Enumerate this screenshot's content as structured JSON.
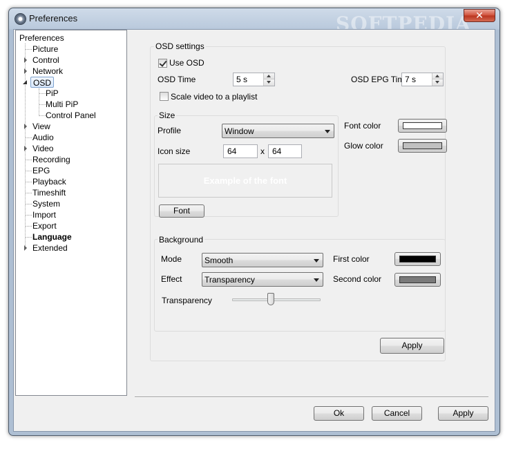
{
  "window": {
    "title": "Preferences",
    "watermark": "SOFTPEDIA",
    "close_symbol": "✕"
  },
  "tree": {
    "root": "Preferences",
    "items": [
      {
        "label": "Picture",
        "has_children": false
      },
      {
        "label": "Control",
        "has_children": true
      },
      {
        "label": "Network",
        "has_children": true
      },
      {
        "label": "OSD",
        "has_children": true,
        "expanded": true,
        "selected": true,
        "children": [
          "PiP",
          "Multi PiP",
          "Control Panel"
        ]
      },
      {
        "label": "View",
        "has_children": true
      },
      {
        "label": "Audio",
        "has_children": false
      },
      {
        "label": "Video",
        "has_children": true
      },
      {
        "label": "Recording",
        "has_children": false
      },
      {
        "label": "EPG",
        "has_children": false
      },
      {
        "label": "Playback",
        "has_children": false
      },
      {
        "label": "Timeshift",
        "has_children": false
      },
      {
        "label": "System",
        "has_children": false
      },
      {
        "label": "Import",
        "has_children": false
      },
      {
        "label": "Export",
        "has_children": false
      },
      {
        "label": "Language",
        "has_children": false,
        "bold": true
      },
      {
        "label": "Extended",
        "has_children": true
      }
    ]
  },
  "osd": {
    "group_title": "OSD settings",
    "use_osd_label": "Use OSD",
    "use_osd_checked": true,
    "osd_time_label": "OSD Time",
    "osd_time_value": "5 s",
    "osd_epg_time_label": "OSD EPG Time",
    "osd_epg_time_value": "7 s",
    "scale_video_label": "Scale video to a playlist",
    "scale_video_checked": false
  },
  "size": {
    "group_title": "Size",
    "profile_label": "Profile",
    "profile_value": "Window",
    "icon_size_label": "Icon size",
    "icon_width": "64",
    "icon_x": "x",
    "icon_height": "64",
    "preview_text": "Example of the font",
    "font_button": "Font"
  },
  "colors": {
    "font_color_label": "Font color",
    "font_color": "#ffffff",
    "glow_color_label": "Glow color",
    "glow_color": "#c0c0c0"
  },
  "background": {
    "group_title": "Background",
    "mode_label": "Mode",
    "mode_value": "Smooth",
    "effect_label": "Effect",
    "effect_value": "Transparency",
    "first_color_label": "First color",
    "first_color": "#000000",
    "second_color_label": "Second color",
    "second_color": "#7a7a7a",
    "transparency_label": "Transparency",
    "transparency_level": 0.43
  },
  "panel_apply": "Apply",
  "footer": {
    "ok": "Ok",
    "cancel": "Cancel",
    "apply": "Apply"
  }
}
